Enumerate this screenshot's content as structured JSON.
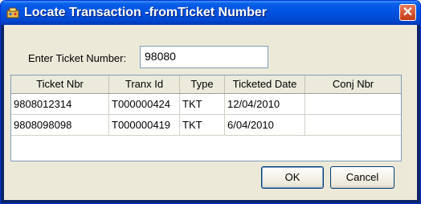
{
  "window": {
    "title": "Locate Transaction -fromTicket Number"
  },
  "form": {
    "label": "Enter Ticket Number:",
    "value": "98080"
  },
  "table": {
    "columns": [
      "Ticket Nbr",
      "Tranx Id",
      "Type",
      "Ticketed Date",
      "Conj Nbr"
    ],
    "rows": [
      [
        "9808012314",
        "T000000424",
        "TKT",
        "12/04/2010",
        ""
      ],
      [
        "9808098098",
        "T000000419",
        "TKT",
        "6/04/2010",
        ""
      ]
    ]
  },
  "buttons": {
    "ok": "OK",
    "cancel": "Cancel"
  }
}
